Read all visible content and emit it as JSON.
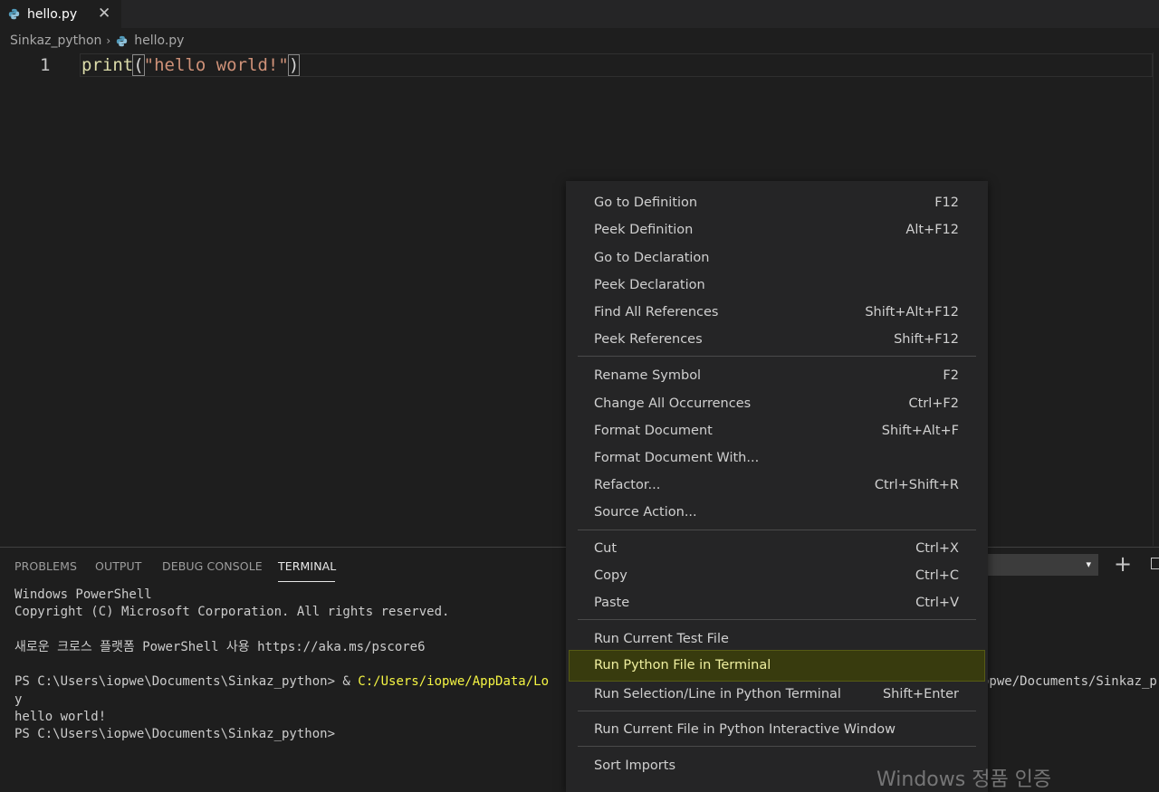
{
  "tabs": [
    {
      "label": "hello.py",
      "icon": "python-icon",
      "close_glyph": "✕"
    }
  ],
  "breadcrumb": {
    "folder": "Sinkaz_python",
    "separator": "›",
    "file": "hello.py"
  },
  "editor": {
    "line_number": "1",
    "code": {
      "fn": "print",
      "open_paren": "(",
      "string": "\"hello world!\"",
      "close_paren": ")"
    }
  },
  "panel": {
    "tabs": [
      "PROBLEMS",
      "OUTPUT",
      "DEBUG CONSOLE",
      "TERMINAL"
    ],
    "active_tab": "TERMINAL",
    "dropdown_arrow": "▾",
    "add_icon": "plus-icon",
    "split_icon": "split-terminal-icon"
  },
  "terminal": {
    "lines": [
      "Windows PowerShell",
      "Copyright (C) Microsoft Corporation. All rights reserved.",
      "",
      "새로운 크로스 플랫폼 PowerShell 사용 https://aka.ms/pscore6",
      ""
    ],
    "prompt_line": {
      "prompt": "PS C:\\Users\\iopwe\\Documents\\Sinkaz_python> & ",
      "path": "C:/Users/iopwe/AppData/Lo",
      "rest": "",
      "tail": "opwe/Documents/Sinkaz_p"
    },
    "after_lines": [
      "y",
      "hello world!",
      "PS C:\\Users\\iopwe\\Documents\\Sinkaz_python>"
    ]
  },
  "context_menu": {
    "groups": [
      [
        {
          "label": "Go to Definition",
          "shortcut": "F12"
        },
        {
          "label": "Peek Definition",
          "shortcut": "Alt+F12"
        },
        {
          "label": "Go to Declaration",
          "shortcut": ""
        },
        {
          "label": "Peek Declaration",
          "shortcut": ""
        },
        {
          "label": "Find All References",
          "shortcut": "Shift+Alt+F12"
        },
        {
          "label": "Peek References",
          "shortcut": "Shift+F12"
        }
      ],
      [
        {
          "label": "Rename Symbol",
          "shortcut": "F2"
        },
        {
          "label": "Change All Occurrences",
          "shortcut": "Ctrl+F2"
        },
        {
          "label": "Format Document",
          "shortcut": "Shift+Alt+F"
        },
        {
          "label": "Format Document With...",
          "shortcut": ""
        },
        {
          "label": "Refactor...",
          "shortcut": "Ctrl+Shift+R"
        },
        {
          "label": "Source Action...",
          "shortcut": ""
        }
      ],
      [
        {
          "label": "Cut",
          "shortcut": "Ctrl+X"
        },
        {
          "label": "Copy",
          "shortcut": "Ctrl+C"
        },
        {
          "label": "Paste",
          "shortcut": "Ctrl+V"
        }
      ],
      [
        {
          "label": "Run Current Test File",
          "shortcut": ""
        },
        {
          "label": "Run Python File in Terminal",
          "shortcut": "",
          "highlighted": true
        },
        {
          "label": "Run Selection/Line in Python Terminal",
          "shortcut": "Shift+Enter"
        }
      ],
      [
        {
          "label": "Run Current File in Python Interactive Window",
          "shortcut": ""
        }
      ],
      [
        {
          "label": "Sort Imports",
          "shortcut": ""
        }
      ]
    ]
  },
  "watermark": "Windows 정품 인증",
  "colors": {
    "highlight_bg": "#383b0e",
    "terminal_path": "#f5f543",
    "string": "#ce9178",
    "function": "#dcdcaa"
  }
}
